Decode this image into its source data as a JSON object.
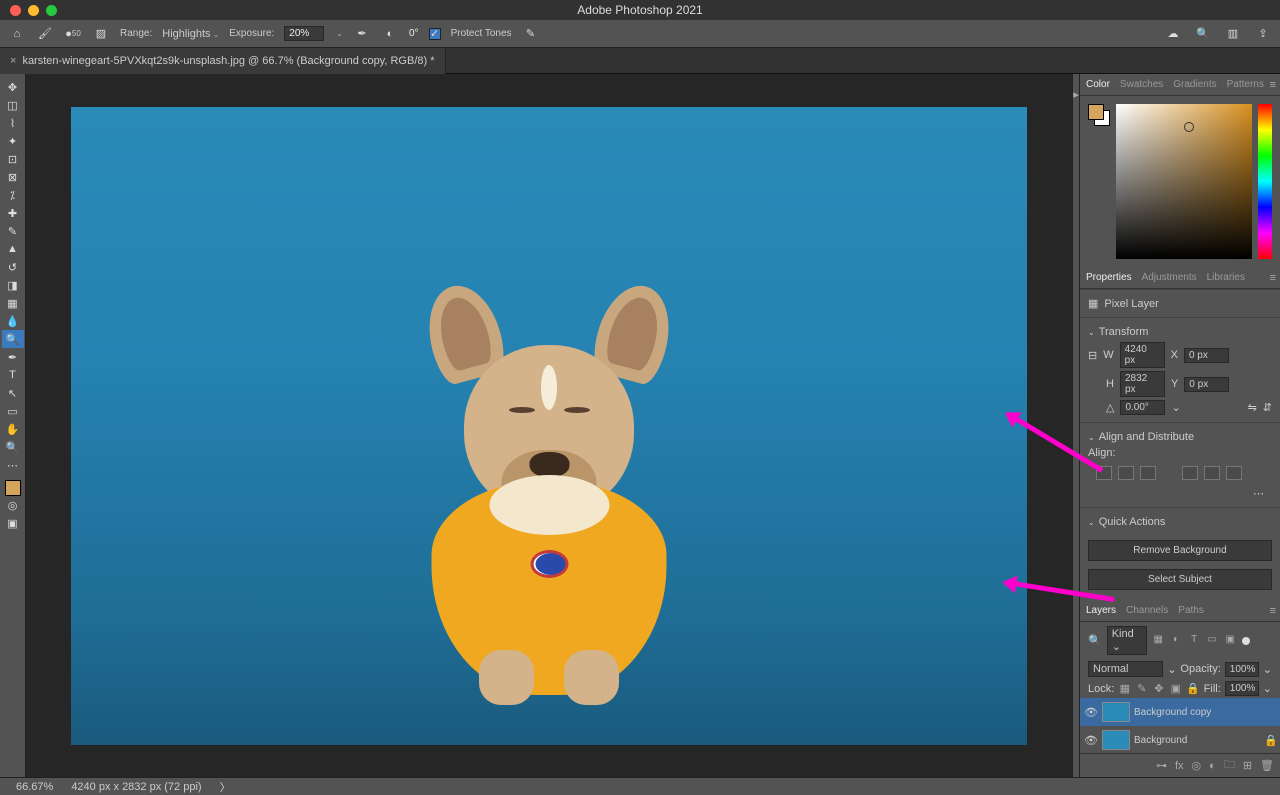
{
  "app": {
    "title": "Adobe Photoshop 2021"
  },
  "options_bar": {
    "range_label": "Range:",
    "range_value": "Highlights",
    "exposure_label": "Exposure:",
    "exposure_value": "20%",
    "angle": "0°",
    "protect_tones": "Protect Tones"
  },
  "tab": {
    "filename": "karsten-winegeart-5PVXkqt2s9k-unsplash.jpg @ 66.7% (Background copy, RGB/8) *"
  },
  "color_panel": {
    "tabs": [
      "Color",
      "Swatches",
      "Gradients",
      "Patterns"
    ]
  },
  "properties": {
    "tabs": [
      "Properties",
      "Adjustments",
      "Libraries"
    ],
    "layer_type": "Pixel Layer",
    "transform_label": "Transform",
    "w": "4240 px",
    "h": "2832 px",
    "x": "0 px",
    "y": "0 px",
    "angle": "0.00°",
    "align_label": "Align and Distribute",
    "align_sub": "Align:",
    "quick_actions_label": "Quick Actions",
    "remove_bg": "Remove Background",
    "select_subject": "Select Subject"
  },
  "layers": {
    "tabs": [
      "Layers",
      "Channels",
      "Paths"
    ],
    "kind": "Kind",
    "blend": "Normal",
    "opacity_label": "Opacity:",
    "opacity": "100%",
    "lock_label": "Lock:",
    "fill_label": "Fill:",
    "fill": "100%",
    "items": [
      {
        "name": "Background copy",
        "selected": true,
        "locked": false
      },
      {
        "name": "Background",
        "selected": false,
        "locked": true
      }
    ]
  },
  "status": {
    "zoom": "66.67%",
    "dims": "4240 px x 2832 px (72 ppi)"
  }
}
